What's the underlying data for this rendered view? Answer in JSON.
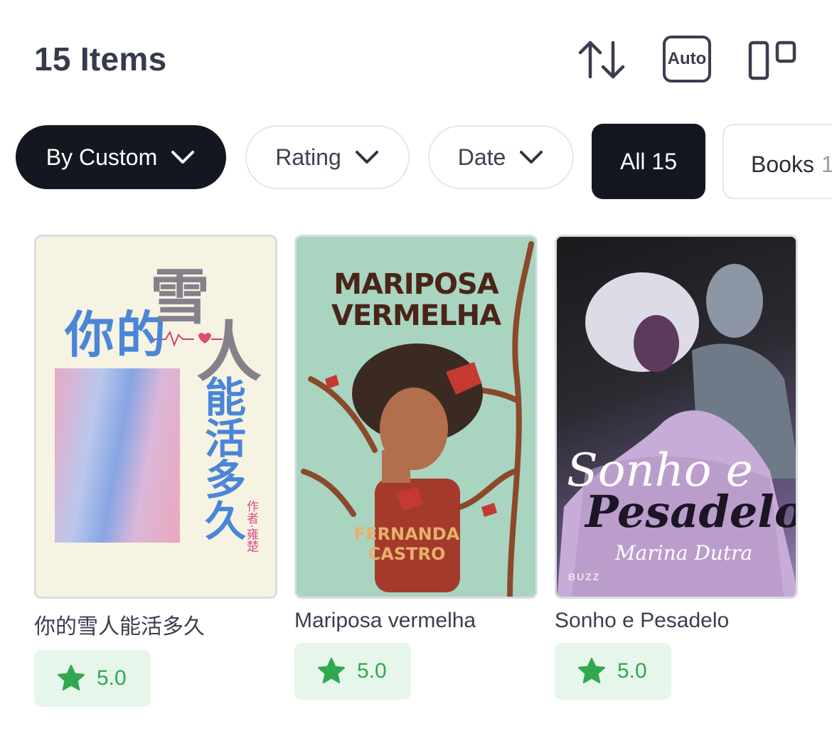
{
  "header": {
    "title": "15 Items",
    "auto_label": "Auto"
  },
  "filters": {
    "sort_chip": "By Custom",
    "rating_chip": "Rating",
    "date_chip": "Date"
  },
  "tabs": [
    {
      "label": "All 15",
      "active": true
    },
    {
      "label": "Books",
      "count": "1"
    }
  ],
  "books": [
    {
      "title": "你的雪人能活多久",
      "rating": "5.0",
      "cover_text": {
        "line_a": "你的",
        "line_b": "雪",
        "line_c": "人",
        "line_d": "能活多久",
        "author": "作者·雍楚"
      }
    },
    {
      "title": "Mariposa vermelha",
      "rating": "5.0",
      "cover_text": {
        "line_a": "MARIPOSA",
        "line_b": "VERMELHA",
        "author_a": "FERNANDA",
        "author_b": "CASTRO"
      }
    },
    {
      "title": "Sonho e Pesadelo",
      "rating": "5.0",
      "cover_text": {
        "line_a": "Sonho e",
        "line_b": "Pesadelo",
        "author": "Marina Dutra",
        "publisher": "BUZZ"
      }
    }
  ],
  "colors": {
    "dark_chip": "#151720",
    "rating_bg": "#e7f6ea",
    "rating_star": "#2fa84f"
  },
  "icons": {
    "sort": "sort-arrows-icon",
    "auto": "auto-layout-icon",
    "layout": "grid-layout-icon",
    "chevron": "chevron-down-icon",
    "star": "star-icon"
  }
}
